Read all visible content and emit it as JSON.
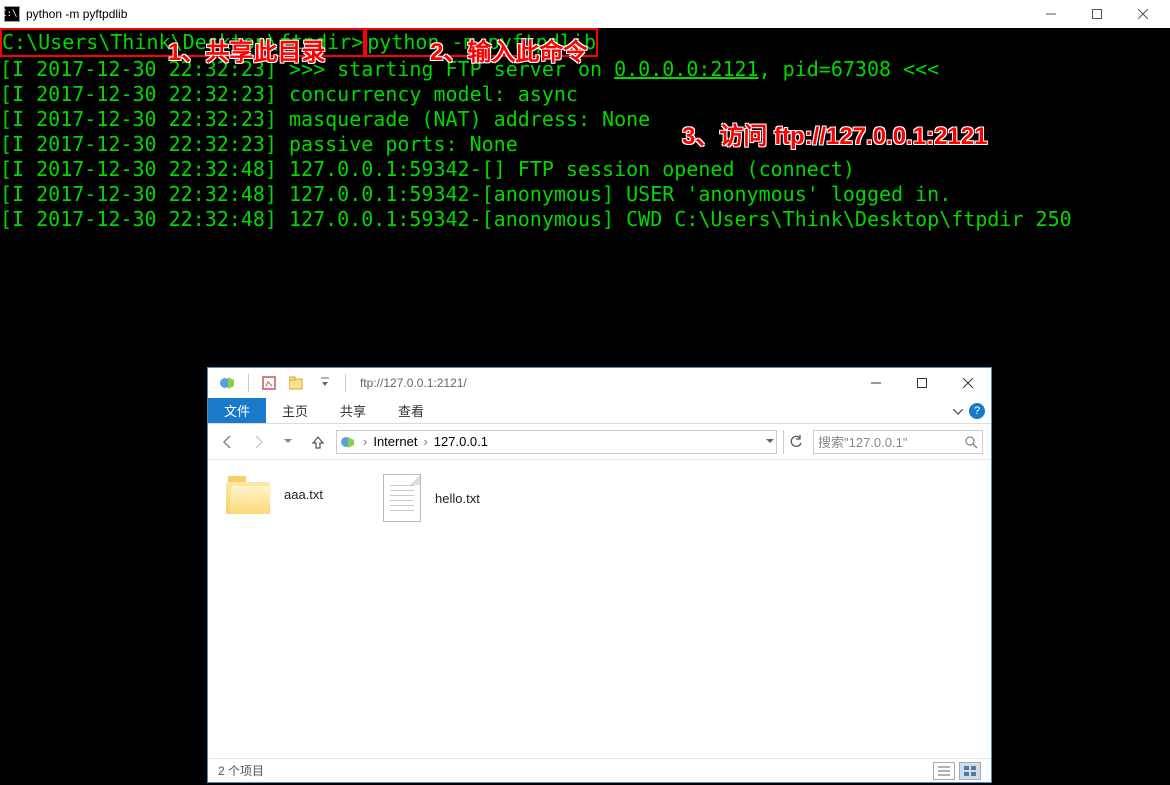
{
  "terminal": {
    "title": "python  -m pyftpdlib",
    "icon_text": "C:\\.",
    "prompt_path": "C:\\Users\\Think\\Desktop\\ftpdir>",
    "command": "python -m pyftpdlib",
    "lines": {
      "l1_a": "[I 2017-12-30 22:32:23] >>> starting FTP server on ",
      "l1_b": "0.0.0.0:2121",
      "l1_c": ", pid=67308 <<<",
      "l2": "[I 2017-12-30 22:32:23] concurrency model: async",
      "l3": "[I 2017-12-30 22:32:23] masquerade (NAT) address: None",
      "l4": "[I 2017-12-30 22:32:23] passive ports: None",
      "l5": "[I 2017-12-30 22:32:48] 127.0.0.1:59342-[] FTP session opened (connect)",
      "l6": "[I 2017-12-30 22:32:48] 127.0.0.1:59342-[anonymous] USER 'anonymous' logged in.",
      "l7": "[I 2017-12-30 22:32:48] 127.0.0.1:59342-[anonymous] CWD C:\\Users\\Think\\Desktop\\ftpdir 250"
    }
  },
  "annotations": {
    "a1": "1、共享此目录",
    "a2": "2、输入此命令",
    "a3": "3、访问 ftp://127.0.0.1:2121"
  },
  "explorer": {
    "titlebar_path": "ftp://127.0.0.1:2121/",
    "tabs": {
      "file": "文件",
      "home": "主页",
      "share": "共享",
      "view": "查看"
    },
    "breadcrumb": {
      "root": "Internet",
      "leaf": "127.0.0.1"
    },
    "search_placeholder": "搜索\"127.0.0.1\"",
    "files": {
      "f1": "aaa.txt",
      "f2": "hello.txt"
    },
    "status": "2 个项目",
    "help": "?"
  }
}
